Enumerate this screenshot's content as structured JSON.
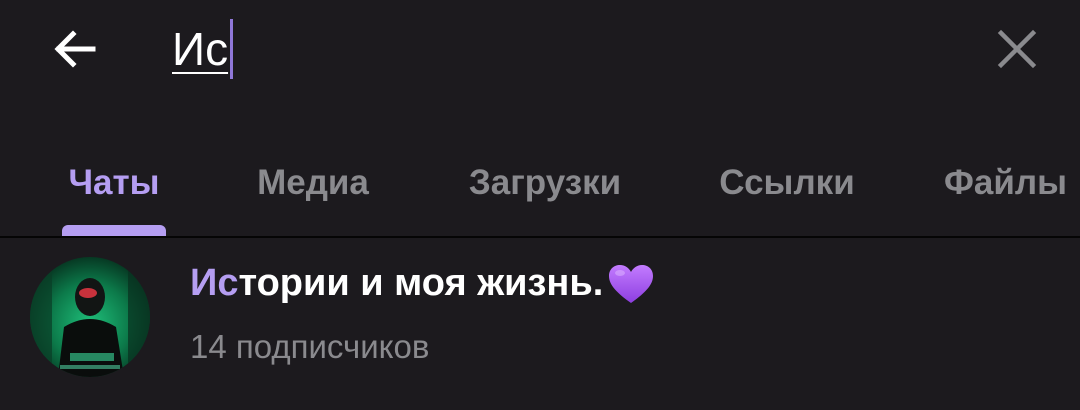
{
  "search": {
    "query": "Ис"
  },
  "icons": {
    "back": "arrow-left-icon",
    "clear": "close-icon",
    "heart": "purple-heart-icon"
  },
  "tabs": [
    {
      "label": "Чаты",
      "active": true
    },
    {
      "label": "Медиа",
      "active": false
    },
    {
      "label": "Загрузки",
      "active": false
    },
    {
      "label": "Ссылки",
      "active": false
    },
    {
      "label": "Файлы",
      "active": false
    }
  ],
  "results": [
    {
      "title_highlight": "Ис",
      "title_rest": "тории и моя жизнь.",
      "subtitle": "14 подписчиков"
    }
  ],
  "colors": {
    "background": "#1c1a1e",
    "accent": "#b59ef2",
    "caret": "#8f77d8",
    "muted_text": "#8a8a8e",
    "heart": "#a35ee8"
  }
}
